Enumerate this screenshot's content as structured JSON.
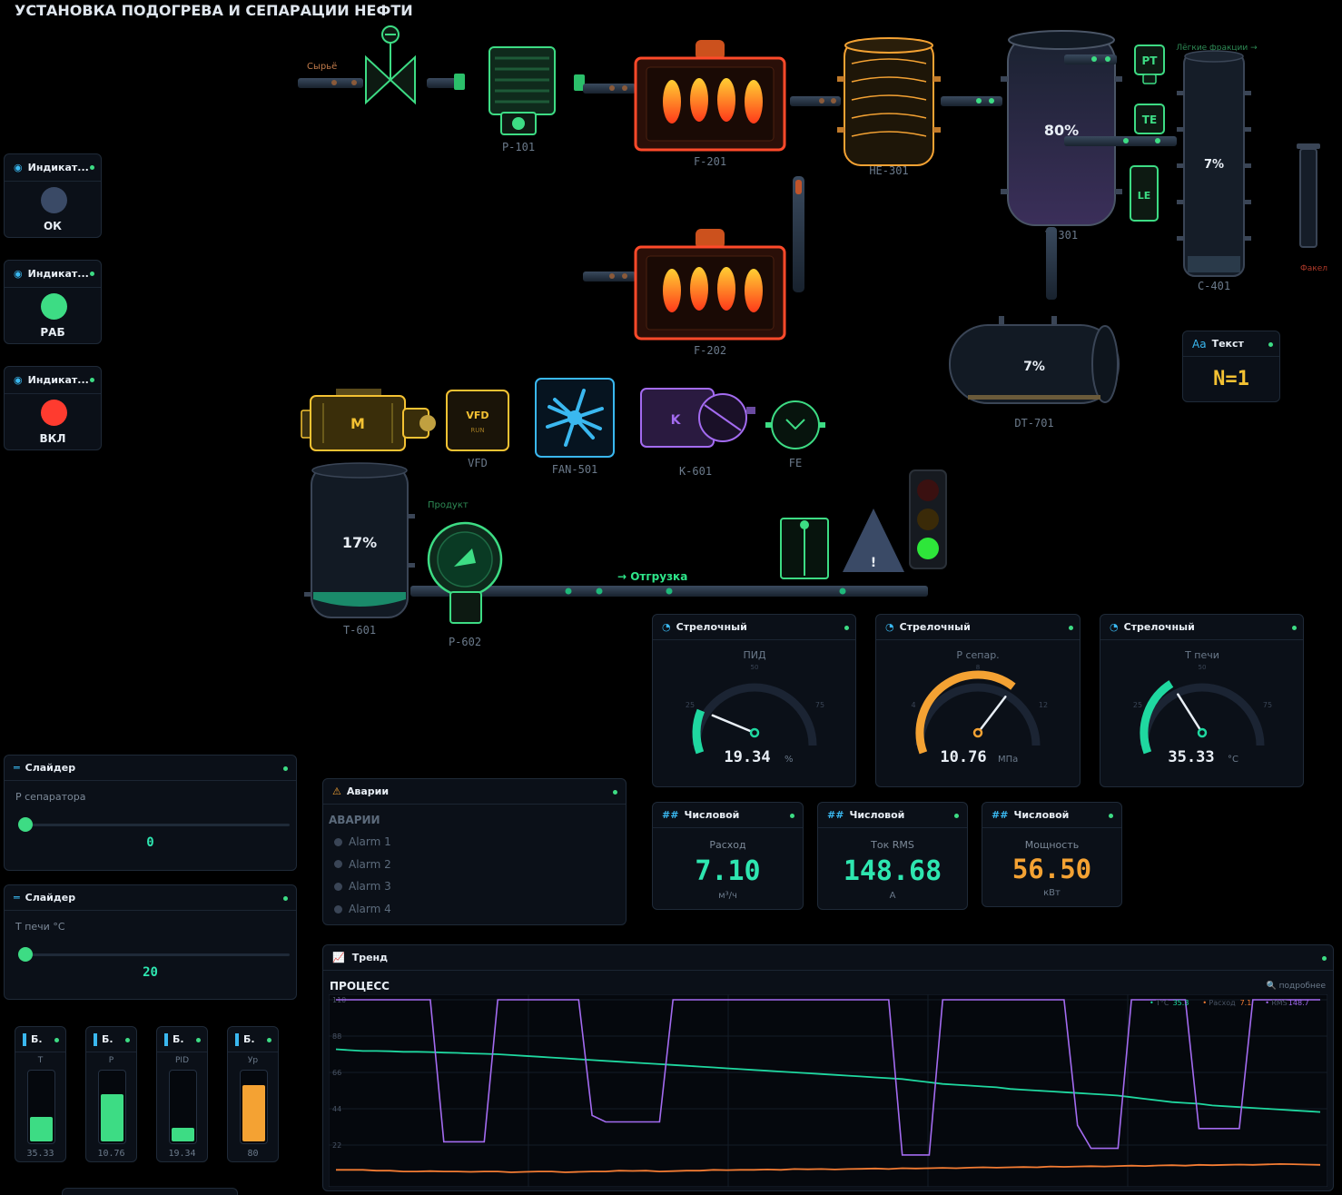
{
  "title": "УСТАНОВКА ПОДОГРЕВА И СЕПАРАЦИИ НЕФТИ",
  "indicators": [
    {
      "header": "Индикат...",
      "state": "ОК",
      "color": "#3a4a66"
    },
    {
      "header": "Индикат...",
      "state": "РАБ",
      "color": "#3ddc84"
    },
    {
      "header": "Индикат...",
      "state": "ВКЛ",
      "color": "#ff3b2f"
    }
  ],
  "equipment": {
    "valve_label": "Сырьё",
    "pump1": "P-101",
    "furnace1": "F-201",
    "furnace2": "F-202",
    "he": "HE-301",
    "sep": "V-301",
    "sep_level": "80%",
    "col": "C-401",
    "col_level": "7%",
    "pt": "PT",
    "te": "TE",
    "le": "LE",
    "light": "Лёгкие фракции →",
    "flare": "Факел",
    "dt": "DT-701",
    "dt_level": "7%",
    "motor": "M",
    "vfd": "VFD",
    "vfd_label": "VFD",
    "vfd_run": "RUN",
    "fan": "FAN-501",
    "comp": "K-601",
    "comp_letter": "K",
    "fe": "FE",
    "tank": "T-601",
    "tank_level": "17%",
    "pump2": "P-602",
    "product": "Продукт",
    "ship": "→ Отгрузка",
    "warn": "!"
  },
  "text_widget": {
    "header": "Текст",
    "icon": "Aa",
    "value": "N=1"
  },
  "gauges": [
    {
      "header": "Стрелочный",
      "label": "ПИД",
      "value": "19.34",
      "unit": "%",
      "min_lbl": "25",
      "max_lbl": "75",
      "mid_lbl": "50",
      "fraction": 0.1934,
      "color": "#1fd8a0"
    },
    {
      "header": "Стрелочный",
      "label": "P сепар.",
      "value": "10.76",
      "unit": "МПа",
      "min_lbl": "4",
      "max_lbl": "12",
      "mid_lbl": "8",
      "fraction": 0.67,
      "color": "#f4a233"
    },
    {
      "header": "Стрелочный",
      "label": "T печи",
      "value": "35.33",
      "unit": "°C",
      "min_lbl": "25",
      "max_lbl": "75",
      "mid_lbl": "50",
      "fraction": 0.3533,
      "color": "#1fd8a0"
    }
  ],
  "numerics": [
    {
      "header": "Числовой",
      "icon": "##",
      "label": "Расход",
      "value": "7.10",
      "unit": "м³/ч",
      "color": "#2ee6b0"
    },
    {
      "header": "Числовой",
      "icon": "##",
      "label": "Ток RMS",
      "value": "148.68",
      "unit": "A",
      "color": "#2ee6b0"
    },
    {
      "header": "Числовой",
      "icon": "##",
      "label": "Мощность",
      "value": "56.50",
      "unit": "кВт",
      "color": "#f4a233"
    }
  ],
  "alarms": {
    "header": "Аварии",
    "title": "АВАРИИ",
    "items": [
      "Alarm 1",
      "Alarm 2",
      "Alarm 3",
      "Alarm 4"
    ]
  },
  "sliders": [
    {
      "header": "Слайдер",
      "label": "P сепаратора",
      "value": "0",
      "fraction": 0
    },
    {
      "header": "Слайдер",
      "label": "T печи °C",
      "value": "20",
      "fraction": 0
    }
  ],
  "bars": [
    {
      "header": "Б.",
      "label": "T",
      "value": "35.33",
      "fraction": 0.35,
      "color": "#3ddc84"
    },
    {
      "header": "Б.",
      "label": "P",
      "value": "10.76",
      "fraction": 0.67,
      "color": "#3ddc84"
    },
    {
      "header": "Б.",
      "label": "PID",
      "value": "19.34",
      "fraction": 0.19,
      "color": "#3ddc84"
    },
    {
      "header": "Б.",
      "label": "Ур",
      "value": "80",
      "fraction": 0.8,
      "color": "#f4a233"
    }
  ],
  "trend": {
    "header": "Тренд",
    "title": "ПРОЦЕСС",
    "more": "подробнее",
    "yticks": [
      "110",
      "88",
      "66",
      "44",
      "22"
    ],
    "legend": [
      {
        "name": "T°C",
        "value": "35.3",
        "color": "#1fd8a0"
      },
      {
        "name": "Расход",
        "value": "7.1",
        "color": "#f47c33"
      },
      {
        "name": "RMS",
        "value": "148.7",
        "color": "#a36bf0"
      }
    ]
  },
  "chart_data": {
    "type": "line",
    "ylim": [
      0,
      110
    ],
    "yticks": [
      22,
      44,
      66,
      88,
      110
    ],
    "series": [
      {
        "name": "T°C",
        "values": [
          80,
          79.5,
          79,
          79,
          78.8,
          78.5,
          78.5,
          78.3,
          78,
          77.8,
          77.5,
          77.3,
          77,
          76.5,
          76,
          75.5,
          75,
          74.5,
          74,
          73.5,
          73,
          72.5,
          72,
          71.5,
          71,
          70.5,
          70,
          69.5,
          69,
          68.5,
          68,
          67.5,
          67,
          66.5,
          66,
          65.5,
          65,
          64.5,
          64,
          63.5,
          63,
          62.5,
          62,
          61,
          60,
          59,
          58.5,
          58,
          57.5,
          57,
          56,
          55.5,
          55,
          54.5,
          54,
          53.5,
          53,
          52.5,
          52,
          51,
          50,
          49,
          48,
          47.5,
          47,
          46,
          45.5,
          45,
          44.5,
          44,
          43.5,
          43,
          42.5,
          42
        ]
      },
      {
        "name": "Расход",
        "values": [
          7,
          7,
          7,
          6.5,
          6.5,
          6,
          6,
          6.2,
          6,
          6,
          5.8,
          6,
          6,
          5.5,
          5.8,
          6,
          6,
          5.5,
          5.8,
          6,
          6,
          6.5,
          6.3,
          6.5,
          6,
          6.2,
          6.5,
          6.5,
          7,
          6.8,
          7,
          7,
          7.2,
          7,
          7.5,
          7.3,
          7.5,
          7.2,
          7.5,
          7.6,
          7.8,
          7.5,
          8,
          7.8,
          8,
          8.2,
          8,
          8.3,
          8.5,
          8.3,
          8.5,
          8.7,
          8.5,
          9,
          8.8,
          9,
          9.2,
          9,
          9.3,
          9.5,
          9.3,
          9.6,
          9.8,
          9.5,
          10,
          9.8,
          10,
          10.2,
          10,
          10.3,
          10.5,
          10.4,
          10.2,
          10
        ]
      },
      {
        "name": "RMS",
        "values": [
          110,
          110,
          110,
          110,
          110,
          110,
          110,
          110,
          24,
          24,
          24,
          24,
          110,
          110,
          110,
          110,
          110,
          110,
          110,
          40,
          36,
          36,
          36,
          36,
          36,
          110,
          110,
          110,
          110,
          110,
          110,
          110,
          110,
          110,
          110,
          110,
          110,
          110,
          110,
          110,
          110,
          110,
          16,
          16,
          16,
          110,
          110,
          110,
          110,
          110,
          110,
          110,
          110,
          110,
          110,
          34,
          20,
          20,
          20,
          110,
          110,
          110,
          110,
          110,
          32,
          32,
          32,
          32,
          110,
          110,
          110,
          110,
          110,
          110
        ]
      }
    ]
  }
}
